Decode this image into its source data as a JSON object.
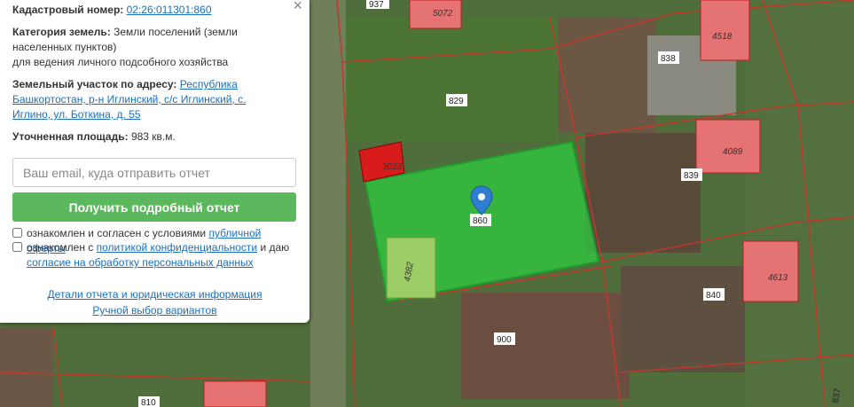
{
  "map": {
    "parcel_numbers": [
      "937",
      "829",
      "838",
      "839",
      "840",
      "900",
      "810",
      "837",
      "860"
    ],
    "building_numbers": [
      "5072",
      "4518",
      "3023",
      "4089",
      "4382",
      "4613"
    ],
    "selected_parcel": "860",
    "colors": {
      "parcel_border": "#c0392b",
      "selection_fill": "#2ecc40",
      "building_fill": "#e57373"
    }
  },
  "panel": {
    "cadastral_label": "Кадастровый номер:",
    "cadastral_value": "02:26:011301:860",
    "category_label": "Категория земель:",
    "category_value_1": "Земли поселений (земли",
    "category_value_2": "населенных пунктов)",
    "usage": "для ведения личного подсобного хозяйства",
    "address_label": "Земельный участок по адресу:",
    "address_link_1": "Республика",
    "address_link_2": "Башкортостан, р-н Иглинский, с/с Иглинский, с.",
    "address_link_3": "Иглино, ул. Боткина, д. 55",
    "area_label": "Уточненная площадь:",
    "area_value": "983 кв.м.",
    "email_placeholder": "Ваш email, куда отправить отчет",
    "submit_label": "Получить подробный отчет",
    "consent1_text": "ознакомлен и согласен с условиями",
    "consent1_link": "публичной оферты",
    "consent2_text": "ознакомлен с",
    "consent2_link": "политикой конфиденциальности",
    "consent2_tail": "и даю",
    "consent2_link2": "согласие на обработку персональных данных",
    "details_link": "Детали отчета и юридическая информация",
    "manual_link": "Ручной выбор вариантов"
  }
}
